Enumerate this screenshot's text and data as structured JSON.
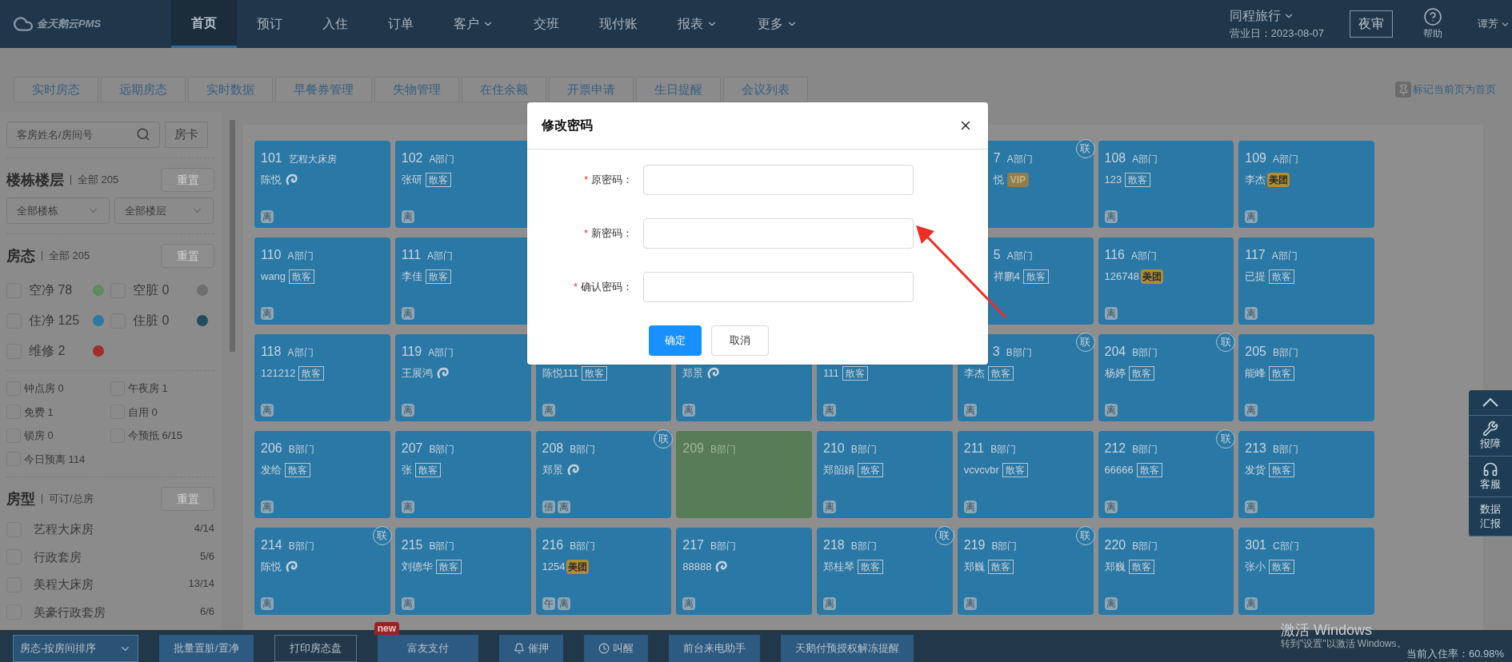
{
  "header": {
    "logo_text": "金天鹅云PMS",
    "nav": [
      {
        "label": "首页",
        "selected": true,
        "dropdown": false
      },
      {
        "label": "预订",
        "selected": false,
        "dropdown": false
      },
      {
        "label": "入住",
        "selected": false,
        "dropdown": false
      },
      {
        "label": "订单",
        "selected": false,
        "dropdown": false
      },
      {
        "label": "客户",
        "selected": false,
        "dropdown": true
      },
      {
        "label": "交班",
        "selected": false,
        "dropdown": false
      },
      {
        "label": "现付账",
        "selected": false,
        "dropdown": false
      },
      {
        "label": "报表",
        "selected": false,
        "dropdown": true
      },
      {
        "label": "更多",
        "selected": false,
        "dropdown": true
      }
    ],
    "hotel": "同程旅行",
    "business_day": "营业日：2023-08-07",
    "night_audit": "夜审",
    "help": "帮助",
    "user": "谭芳"
  },
  "tabs": [
    "实时房态",
    "远期房态",
    "实时数据",
    "早餐券管理",
    "失物管理",
    "在住余额",
    "开票申请",
    "生日提醒",
    "会议列表"
  ],
  "pin_home": "标记当前页为首页",
  "sidebar": {
    "search": {
      "placeholder": "客房姓名/房间号"
    },
    "room_card_button": "房卡",
    "building": {
      "title": "楼栋楼层",
      "count": "全部 205",
      "reset": "重置",
      "selects": [
        "全部楼栋",
        "全部楼层"
      ]
    },
    "status": {
      "title": "房态",
      "count": "全部 205",
      "reset": "重置",
      "items": [
        {
          "label": "空净 78",
          "color": "#5e8c5e",
          "checked": false
        },
        {
          "label": "空脏 0",
          "color": "#6e6e6e",
          "checked": false
        },
        {
          "label": "住净 125",
          "color": "#2b7aa6",
          "checked": false
        },
        {
          "label": "住脏 0",
          "color": "#234b5f",
          "checked": false
        },
        {
          "label": "维修 2",
          "color": "#a52a2a",
          "checked": false
        }
      ]
    },
    "filters": [
      {
        "label": "钟点房 0",
        "checked": false
      },
      {
        "label": "午夜房 1",
        "checked": false
      },
      {
        "label": "免费 1",
        "checked": false
      },
      {
        "label": "自用 0",
        "checked": false
      },
      {
        "label": "锁房 0",
        "checked": false
      },
      {
        "label": "今预抵 6/15",
        "checked": false
      },
      {
        "label": "今日预离 114",
        "checked": false
      }
    ],
    "room_types": {
      "title": "房型",
      "subtitle": "可订/总房",
      "reset": "重置",
      "items": [
        {
          "label": "艺程大床房",
          "count": "4/14",
          "checked": false
        },
        {
          "label": "行政套房",
          "count": "5/6",
          "checked": false
        },
        {
          "label": "美程大床房",
          "count": "13/14",
          "checked": false
        },
        {
          "label": "美豪行政套房",
          "count": "6/6",
          "checked": false
        }
      ]
    }
  },
  "rooms": [
    {
      "kind": "occupied",
      "number": "101",
      "dept": "艺程大床房",
      "guest": "陈悦",
      "badge": {
        "kind": "swirl"
      },
      "marks": [
        "离"
      ]
    },
    {
      "kind": "occupied",
      "number": "102",
      "dept": "A部门",
      "guest": "张研",
      "badge": {
        "kind": "tag",
        "text": "散客"
      },
      "marks": [
        "离"
      ]
    },
    {
      "kind": "covered"
    },
    {
      "kind": "covered"
    },
    {
      "kind": "covered"
    },
    {
      "kind": "cut",
      "number": "7",
      "dept": "A部门",
      "guest": "悦",
      "badge": {
        "kind": "vip",
        "text": "VIP"
      },
      "linked": "联"
    },
    {
      "kind": "occupied",
      "number": "108",
      "dept": "A部门",
      "guest": "123",
      "badge": {
        "kind": "tag",
        "text": "散客"
      },
      "marks": [
        "离"
      ]
    },
    {
      "kind": "occupied",
      "number": "109",
      "dept": "A部门",
      "guest": "李杰",
      "badge": {
        "kind": "meituan",
        "text": "美团"
      },
      "marks": [
        "离"
      ]
    },
    {
      "kind": "occupied",
      "number": "110",
      "dept": "A部门",
      "guest": "wang",
      "badge": {
        "kind": "tag",
        "text": "散客"
      },
      "marks": [
        "离"
      ]
    },
    {
      "kind": "occupied",
      "number": "111",
      "dept": "A部门",
      "guest": "李佳",
      "badge": {
        "kind": "tag",
        "text": "散客"
      },
      "marks": [
        "离"
      ]
    },
    {
      "kind": "covered"
    },
    {
      "kind": "covered"
    },
    {
      "kind": "covered"
    },
    {
      "kind": "cut",
      "number": "5",
      "dept": "A部门",
      "guest": "祥鹏4",
      "badge": {
        "kind": "tag",
        "text": "散客"
      }
    },
    {
      "kind": "occupied",
      "number": "116",
      "dept": "A部门",
      "guest": "126748",
      "badge": {
        "kind": "meituan",
        "text": "美团"
      },
      "marks": [
        "离"
      ]
    },
    {
      "kind": "occupied",
      "number": "117",
      "dept": "A部门",
      "guest": "已提",
      "badge": {
        "kind": "tag",
        "text": "散客"
      },
      "marks": [
        "离"
      ]
    },
    {
      "kind": "occupied",
      "number": "118",
      "dept": "A部门",
      "guest": "121212",
      "badge": {
        "kind": "tag",
        "text": "散客"
      },
      "marks": [
        "离"
      ]
    },
    {
      "kind": "occupied",
      "number": "119",
      "dept": "A部门",
      "guest": "王展鸿",
      "badge": {
        "kind": "swirl"
      },
      "marks": [
        "离"
      ]
    },
    {
      "kind": "occupied",
      "guest": "陈悦111",
      "badge": {
        "kind": "tag",
        "text": "散客"
      },
      "marks": [
        "离"
      ]
    },
    {
      "kind": "occupied",
      "guest": "郑景",
      "badge": {
        "kind": "swirl"
      },
      "marks": [
        "离"
      ]
    },
    {
      "kind": "occupied",
      "guest": "111",
      "badge": {
        "kind": "tag",
        "text": "散客"
      },
      "marks": [
        "离"
      ]
    },
    {
      "kind": "cut_top",
      "number": "3",
      "dept": "B部门",
      "guest": "李杰",
      "badge": {
        "kind": "tag",
        "text": "散客"
      },
      "marks": [
        "离"
      ],
      "linked": "联"
    },
    {
      "kind": "occupied",
      "number": "204",
      "dept": "B部门",
      "guest": "杨婷",
      "badge": {
        "kind": "tag",
        "text": "散客"
      },
      "marks": [
        "离"
      ],
      "linked": "联"
    },
    {
      "kind": "occupied",
      "number": "205",
      "dept": "B部门",
      "guest": "能峰",
      "badge": {
        "kind": "tag",
        "text": "散客"
      },
      "marks": [
        "离"
      ]
    },
    {
      "kind": "occupied",
      "number": "206",
      "dept": "B部门",
      "guest": "发给",
      "badge": {
        "kind": "tag",
        "text": "散客"
      },
      "marks": [
        "离"
      ]
    },
    {
      "kind": "occupied",
      "number": "207",
      "dept": "B部门",
      "guest": "张",
      "badge": {
        "kind": "tag",
        "text": "散客"
      },
      "marks": [
        "离"
      ]
    },
    {
      "kind": "occupied",
      "number": "208",
      "dept": "B部门",
      "guest": "郑景",
      "badge": {
        "kind": "swirl"
      },
      "marks": [
        "借",
        "离"
      ],
      "linked": "联"
    },
    {
      "kind": "vacant",
      "number": "209",
      "dept": "B部门"
    },
    {
      "kind": "occupied",
      "number": "210",
      "dept": "B部门",
      "guest": "郑韶娟",
      "badge": {
        "kind": "tag",
        "text": "散客"
      },
      "marks": [
        "离"
      ]
    },
    {
      "kind": "occupied",
      "number": "211",
      "dept": "B部门",
      "guest": "vcvcvbr",
      "badge": {
        "kind": "tag",
        "text": "散客"
      },
      "marks": [
        "离"
      ]
    },
    {
      "kind": "occupied",
      "number": "212",
      "dept": "B部门",
      "guest": "66666",
      "badge": {
        "kind": "tag",
        "text": "散客"
      },
      "marks": [
        "离"
      ],
      "linked": "联"
    },
    {
      "kind": "occupied",
      "number": "213",
      "dept": "B部门",
      "guest": "发货",
      "badge": {
        "kind": "tag",
        "text": "散客"
      },
      "marks": [
        "离"
      ]
    },
    {
      "kind": "occupied",
      "number": "214",
      "dept": "B部门",
      "guest": "陈悦",
      "badge": {
        "kind": "swirl"
      },
      "marks": [
        "离"
      ],
      "linked": "联"
    },
    {
      "kind": "occupied",
      "number": "215",
      "dept": "B部门",
      "guest": "刘德华",
      "badge": {
        "kind": "tag",
        "text": "散客"
      },
      "marks": [
        "离"
      ]
    },
    {
      "kind": "occupied",
      "number": "216",
      "dept": "B部门",
      "guest": "1254",
      "badge": {
        "kind": "meituan",
        "text": "美团"
      },
      "marks": [
        "午",
        "离"
      ]
    },
    {
      "kind": "occupied",
      "number": "217",
      "dept": "B部门",
      "guest": "88888",
      "badge": {
        "kind": "swirl"
      },
      "marks": [
        "离"
      ]
    },
    {
      "kind": "occupied",
      "number": "218",
      "dept": "B部门",
      "guest": "郑桂琴",
      "badge": {
        "kind": "tag",
        "text": "散客"
      },
      "marks": [
        "离"
      ],
      "linked": "联"
    },
    {
      "kind": "occupied",
      "number": "219",
      "dept": "B部门",
      "guest": "郑巍",
      "badge": {
        "kind": "tag",
        "text": "散客"
      },
      "marks": [
        "离"
      ],
      "linked": "联"
    },
    {
      "kind": "occupied",
      "number": "220",
      "dept": "B部门",
      "guest": "郑巍",
      "badge": {
        "kind": "tag",
        "text": "散客"
      },
      "marks": [
        "离"
      ]
    },
    {
      "kind": "occupied",
      "number": "301",
      "dept": "C部门",
      "guest": "张小",
      "badge": {
        "kind": "tag",
        "text": "散客"
      },
      "marks": [
        "离"
      ]
    }
  ],
  "side_panel": [
    {
      "kind": "up"
    },
    {
      "kind": "wrench",
      "label": "报障"
    },
    {
      "kind": "headset",
      "label": "客服"
    },
    {
      "kind": "text",
      "label": "数据汇报"
    }
  ],
  "bottom_bar": {
    "sort_select": "房态-按房间排序",
    "buttons": [
      {
        "label": "批量置脏/置净",
        "kind": "outline",
        "new": false
      },
      {
        "label": "打印房态盘",
        "kind": "outline",
        "new": false
      },
      {
        "label": "富友支付",
        "kind": "plain",
        "new": true
      },
      {
        "label": "催押",
        "kind": "bell",
        "new": false
      },
      {
        "label": "叫醒",
        "kind": "clock",
        "new": false
      },
      {
        "label": "前台来电助手",
        "kind": "plain",
        "new": false
      },
      {
        "label": "天鹅付预授权解冻提醒",
        "kind": "plain",
        "new": false
      }
    ],
    "new_badge": "new",
    "occupancy": "当前入住率：60.98%"
  },
  "os_watermark": {
    "title": "激活 Windows",
    "text": "转到\"设置\"以激活 Windows。"
  },
  "dialog": {
    "title": "修改密码",
    "fields": [
      {
        "label": "原密码：",
        "required_mark": "*"
      },
      {
        "label": "新密码：",
        "required_mark": "*"
      },
      {
        "label": "确认密码：",
        "required_mark": "*"
      }
    ],
    "confirm": "确定",
    "cancel": "取消"
  },
  "annotation_arrow": true
}
